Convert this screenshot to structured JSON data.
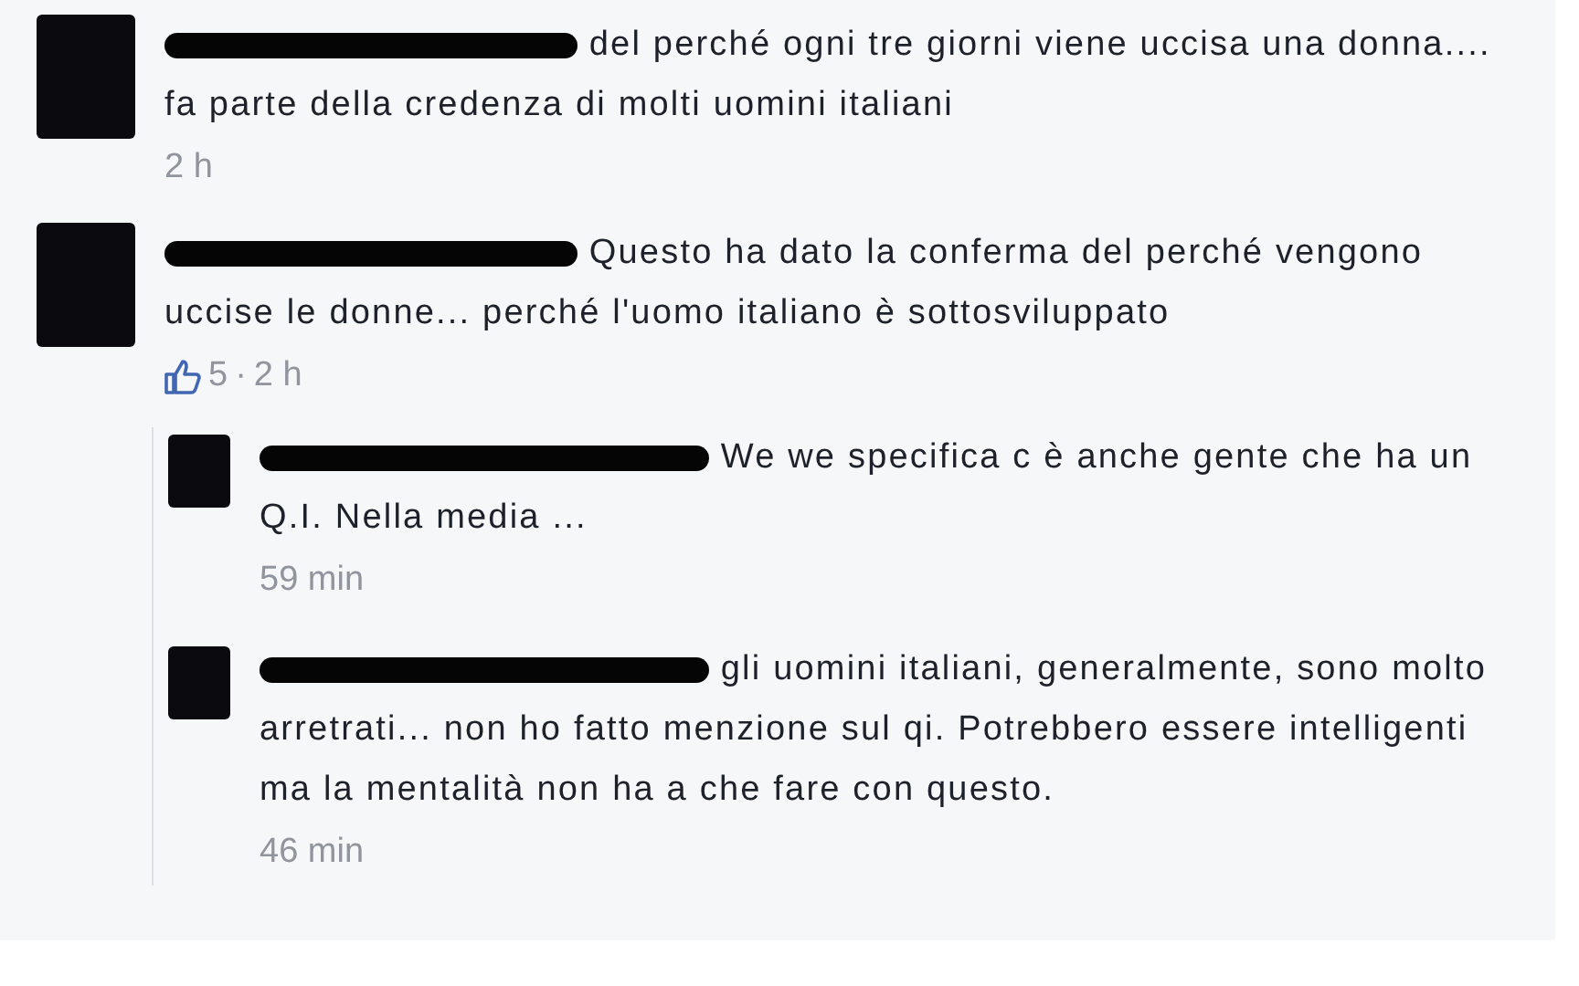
{
  "comments": [
    {
      "text": "del perché ogni tre giorni viene uccisa una donna.... fa parte della credenza di molti uomini italiani",
      "time": "2 h"
    },
    {
      "text": "Questo ha dato la conferma del perché vengono uccise le donne... perché l'uomo italiano è sottosviluppato",
      "likes": "5",
      "separator": "·",
      "time": "2 h",
      "replies": [
        {
          "text": "We we specifica c è anche gente che ha un Q.I. Nella media ...",
          "time": "59 min"
        },
        {
          "text": "gli uomini italiani, generalmente, sono molto arretrati... non ho fatto menzione sul qi. Potrebbero essere intelligenti ma la mentalità non ha a che fare con questo.",
          "time": "46 min"
        }
      ]
    }
  ]
}
